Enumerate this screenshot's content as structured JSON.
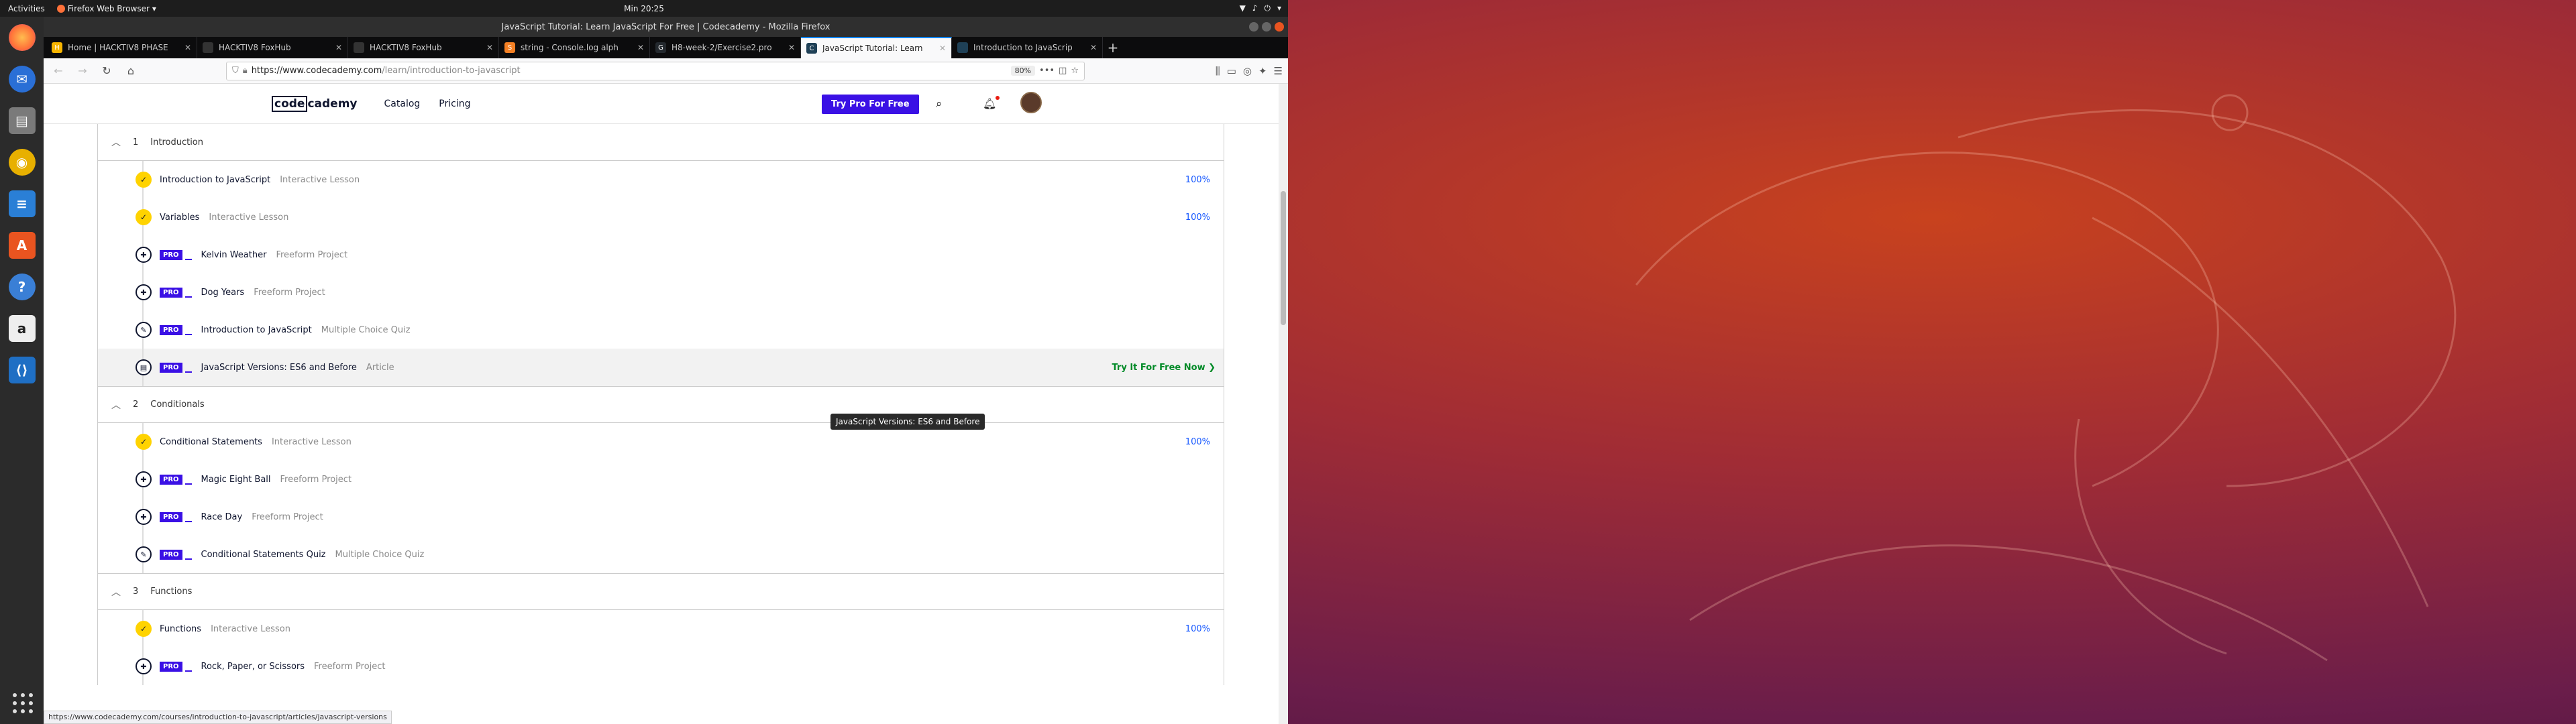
{
  "topbar": {
    "activities": "Activities",
    "app_menu": "Firefox Web Browser",
    "clock": "Min 20:25"
  },
  "dock": {
    "items": [
      "firefox-icon",
      "thunderbird-icon",
      "files-icon",
      "rhythmbox-icon",
      "writer-icon",
      "software-icon",
      "help-icon",
      "amazon-icon",
      "vscode-icon"
    ]
  },
  "window": {
    "title": "JavaScript Tutorial: Learn JavaScript For Free | Codecademy - Mozilla Firefox"
  },
  "tabs": [
    {
      "label": "Home | HACKTIV8 PHASE",
      "fav_color": "#f7b500",
      "fav_glyph": "H"
    },
    {
      "label": "HACKTIV8 FoxHub",
      "fav_color": "#333333",
      "fav_glyph": ""
    },
    {
      "label": "HACKTIV8 FoxHub",
      "fav_color": "#333333",
      "fav_glyph": ""
    },
    {
      "label": "string - Console.log alph",
      "fav_color": "#f48024",
      "fav_glyph": "S"
    },
    {
      "label": "H8-week-2/Exercise2.pro",
      "fav_color": "#24292e",
      "fav_glyph": "G"
    },
    {
      "label": "JavaScript Tutorial: Learn",
      "fav_color": "#1f4056",
      "fav_glyph": "C",
      "active": true
    },
    {
      "label": "Introduction to JavaScrip",
      "fav_color": "#1f4056",
      "fav_glyph": ""
    }
  ],
  "urlbar": {
    "host": "https://www.codecademy.com",
    "path": "/learn/introduction-to-javascript",
    "zoom": "80%"
  },
  "header": {
    "logo_a": "code",
    "logo_b": "cademy",
    "nav": [
      "Catalog",
      "Pricing"
    ],
    "cta": "Try Pro For Free"
  },
  "modules": [
    {
      "num": "1",
      "title": "Introduction",
      "lessons": [
        {
          "title": "Introduction to JavaScript",
          "type": "Interactive Lesson",
          "status": "done",
          "pro": false,
          "pct": "100%",
          "icon": "check"
        },
        {
          "title": "Variables",
          "type": "Interactive Lesson",
          "status": "done",
          "pro": false,
          "pct": "100%",
          "icon": "check"
        },
        {
          "title": "Kelvin Weather",
          "type": "Freeform Project",
          "status": "todo",
          "pro": true,
          "pct": "",
          "icon": "puzzle"
        },
        {
          "title": "Dog Years",
          "type": "Freeform Project",
          "status": "todo",
          "pro": true,
          "pct": "",
          "icon": "puzzle"
        },
        {
          "title": "Introduction to JavaScript",
          "type": "Multiple Choice Quiz",
          "status": "todo",
          "pro": true,
          "pct": "",
          "icon": "quiz"
        },
        {
          "title": "JavaScript Versions: ES6 and Before",
          "type": "Article",
          "status": "todo",
          "pro": true,
          "pct": "",
          "icon": "article",
          "hover": true,
          "try": "Try It For Free Now ❯"
        }
      ]
    },
    {
      "num": "2",
      "title": "Conditionals",
      "lessons": [
        {
          "title": "Conditional Statements",
          "type": "Interactive Lesson",
          "status": "done",
          "pro": false,
          "pct": "100%",
          "icon": "check"
        },
        {
          "title": "Magic Eight Ball",
          "type": "Freeform Project",
          "status": "todo",
          "pro": true,
          "pct": "",
          "icon": "puzzle"
        },
        {
          "title": "Race Day",
          "type": "Freeform Project",
          "status": "todo",
          "pro": true,
          "pct": "",
          "icon": "puzzle"
        },
        {
          "title": "Conditional Statements Quiz",
          "type": "Multiple Choice Quiz",
          "status": "todo",
          "pro": true,
          "pct": "",
          "icon": "quiz"
        }
      ]
    },
    {
      "num": "3",
      "title": "Functions",
      "lessons": [
        {
          "title": "Functions",
          "type": "Interactive Lesson",
          "status": "done",
          "pro": false,
          "pct": "100%",
          "icon": "check"
        },
        {
          "title": "Rock, Paper, or Scissors",
          "type": "Freeform Project",
          "status": "todo",
          "pro": true,
          "pct": "",
          "icon": "puzzle"
        }
      ]
    }
  ],
  "pro_badge": "PRO",
  "tooltip": "JavaScript Versions: ES6 and Before",
  "status_url": "https://www.codecademy.com/courses/introduction-to-javascript/articles/javascript-versions"
}
